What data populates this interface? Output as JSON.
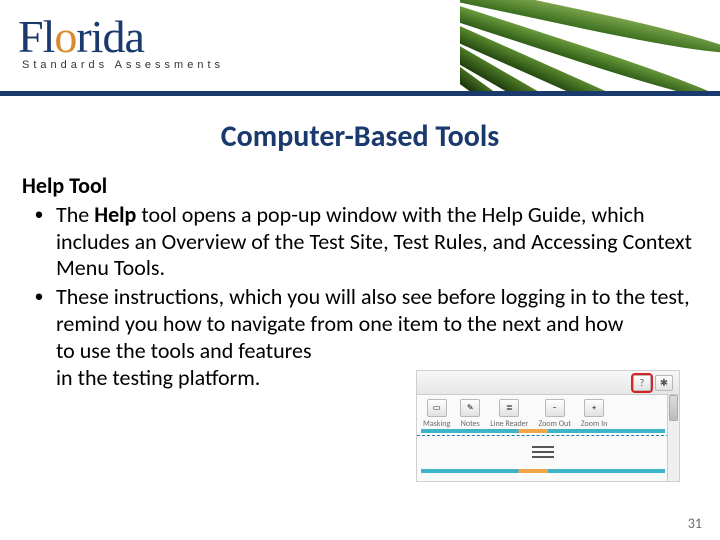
{
  "header": {
    "logo_word": "Florida",
    "logo_subtitle": "Standards Assessments"
  },
  "title": "Computer-Based Tools",
  "subheading": "Help Tool",
  "bullets": [
    {
      "prefix": "The ",
      "bold": "Help",
      "rest": " tool opens a pop-up window with the Help Guide, which includes an Overview of the Test Site, Test Rules, and Accessing Context Menu Tools."
    },
    {
      "prefix": "These instructions, which you will also see before logging in to the test, remind you how to navigate from one item to the next and how",
      "break_lines": [
        "to use the tools and features",
        "in the testing platform."
      ]
    }
  ],
  "inset": {
    "topbar": {
      "help_icon": "?",
      "settings_icon": "✱"
    },
    "tools": [
      {
        "label": "Masking",
        "glyph": "▭"
      },
      {
        "label": "Notes",
        "glyph": "✎"
      },
      {
        "label": "Line Reader",
        "glyph": "≣"
      },
      {
        "label": "Zoom Out",
        "glyph": "−"
      },
      {
        "label": "Zoom In",
        "glyph": "+"
      }
    ]
  },
  "page_number": "31",
  "colors": {
    "brand_navy": "#1a3a6e",
    "brand_orange": "#d98b2e",
    "highlight_red": "#d62424"
  }
}
